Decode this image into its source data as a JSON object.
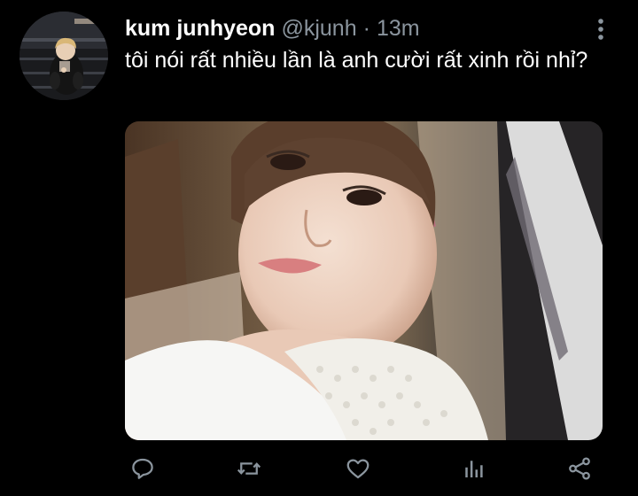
{
  "tweet": {
    "display_name": "kum junhyeon",
    "handle": "@kjunh",
    "separator": "·",
    "time": "13m",
    "text": "tôi nói rất nhiều lần là anh cười rất xinh rồi nhỉ?"
  },
  "icons": {
    "more": "more-vertical-icon",
    "reply": "reply-icon",
    "retweet": "retweet-icon",
    "like": "heart-icon",
    "analytics": "analytics-icon",
    "share": "share-icon"
  },
  "colors": {
    "background": "#000000",
    "primary_text": "#ffffff",
    "secondary_text": "#8b959e",
    "icon": "#8b959e"
  }
}
